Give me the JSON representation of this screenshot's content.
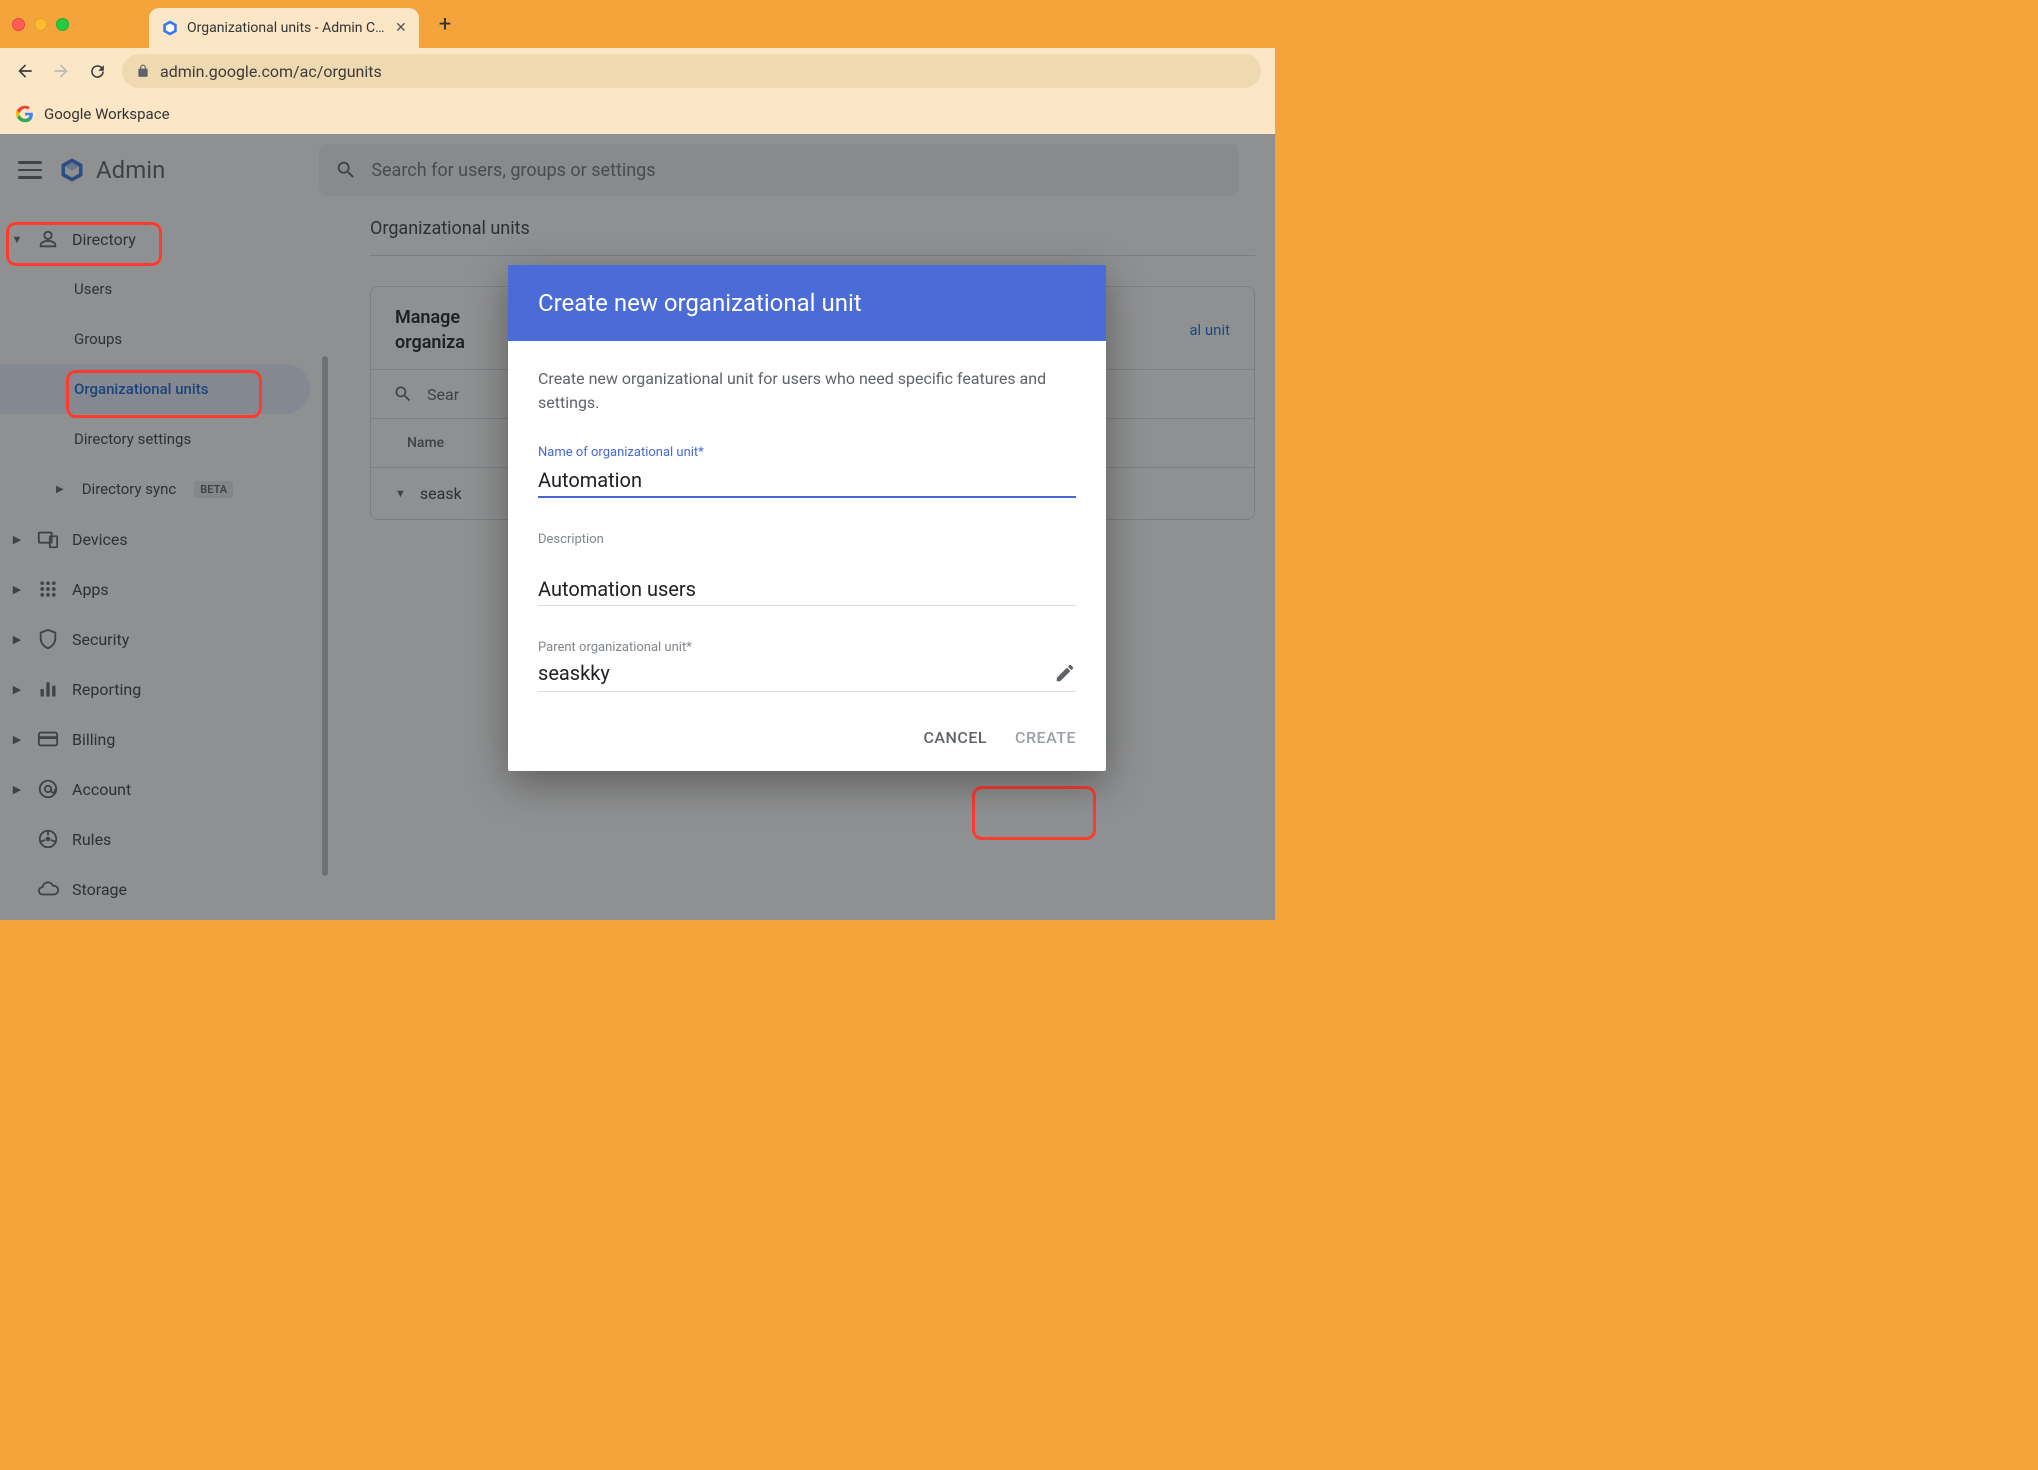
{
  "browser": {
    "tab_title": "Organizational units - Admin C…",
    "url": "admin.google.com/ac/orgunits",
    "bookmark": "Google Workspace"
  },
  "header": {
    "title": "Admin",
    "search_placeholder": "Search for users, groups or settings"
  },
  "sidebar": {
    "directory": "Directory",
    "users": "Users",
    "groups": "Groups",
    "ou": "Organizational units",
    "dir_settings": "Directory settings",
    "dir_sync": "Directory sync",
    "beta": "BETA",
    "devices": "Devices",
    "apps": "Apps",
    "security": "Security",
    "reporting": "Reporting",
    "billing": "Billing",
    "account": "Account",
    "rules": "Rules",
    "storage": "Storage"
  },
  "main": {
    "heading": "Organizational units",
    "panel_title_l1": "Manage",
    "panel_title_l2": "organiza",
    "panel_link_frag": "al unit",
    "panel_search": "Sear",
    "col_name": "Name",
    "row1": "seask"
  },
  "dialog": {
    "title": "Create new organizational unit",
    "desc": "Create new organizational unit for users who need specific features and settings.",
    "name_label": "Name of organizational unit*",
    "name_value": "Automation",
    "desc_label": "Description",
    "desc_value": "Automation users",
    "parent_label": "Parent organizational unit*",
    "parent_value": "seaskky",
    "cancel": "CANCEL",
    "create": "CREATE"
  }
}
